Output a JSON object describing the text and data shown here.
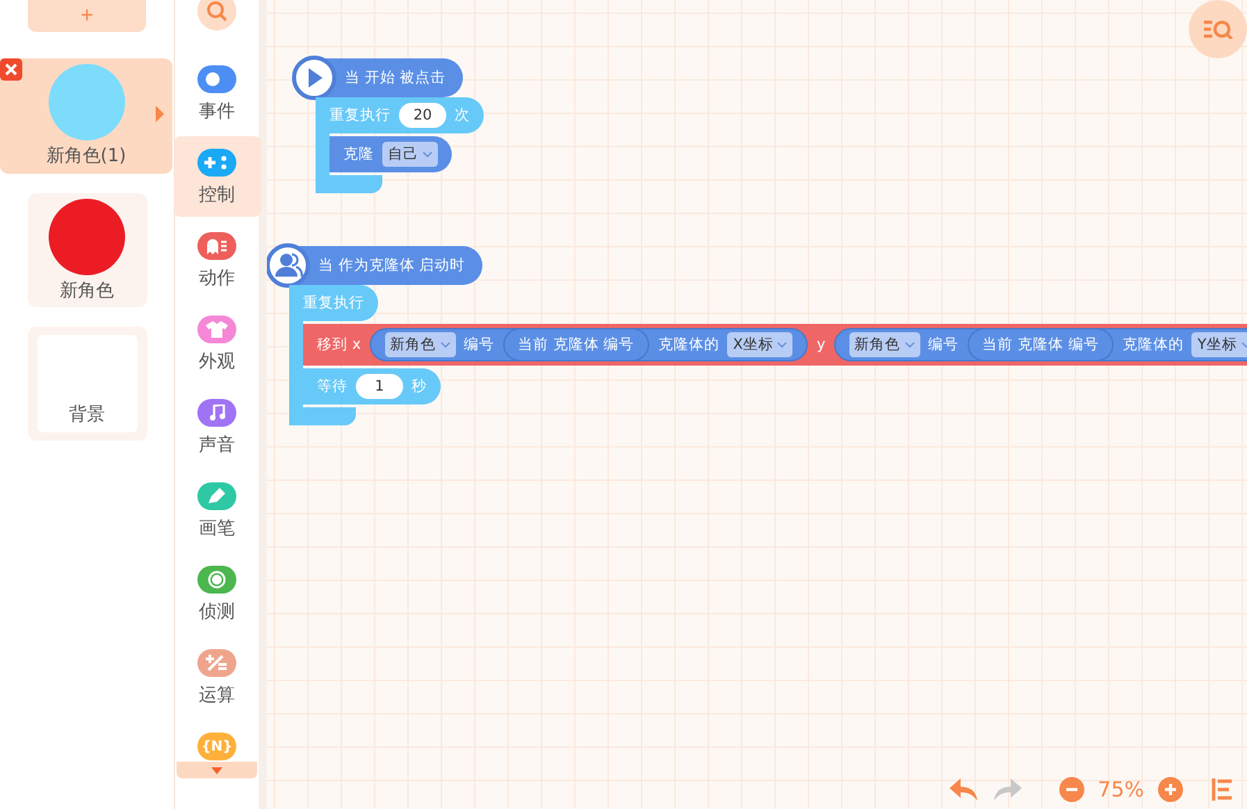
{
  "sprite_panel": {
    "add_label": "+",
    "items": [
      {
        "kind": "sprite",
        "name": "新角色(1)",
        "color": "#7ddcfc",
        "selected": true
      },
      {
        "kind": "sprite",
        "name": "新角色",
        "color": "#ec1c24",
        "selected": false
      },
      {
        "kind": "backdrop",
        "name": "背景",
        "selected": false
      }
    ]
  },
  "categories": [
    {
      "label": "事件",
      "color": "#4d8ef5",
      "selected": false
    },
    {
      "label": "控制",
      "color": "#1aa9f5",
      "selected": true
    },
    {
      "label": "动作",
      "color": "#ee5f5b",
      "selected": false
    },
    {
      "label": "外观",
      "color": "#f587d6",
      "selected": false
    },
    {
      "label": "声音",
      "color": "#a073f5",
      "selected": false
    },
    {
      "label": "画笔",
      "color": "#2ec9a4",
      "selected": false
    },
    {
      "label": "侦测",
      "color": "#4cb64f",
      "selected": false
    },
    {
      "label": "运算",
      "color": "#efa58c",
      "selected": false
    },
    {
      "icon_text": "{N}",
      "color": "#ffb03a",
      "selected": false
    }
  ],
  "scripts": [
    {
      "hat": {
        "kind": "start",
        "label": "当 开始 被点击"
      },
      "blocks": [
        {
          "kind": "c",
          "color": "#67c9f8",
          "parts": [
            {
              "kind": "text",
              "text": "重复执行"
            },
            {
              "kind": "number",
              "text": "20"
            },
            {
              "kind": "text",
              "text": "次"
            }
          ],
          "children": [
            {
              "kind": "stack",
              "color": "#5b8fe6",
              "parts": [
                {
                  "kind": "text",
                  "text": "克隆"
                },
                {
                  "kind": "dropdown",
                  "text": "自己"
                }
              ]
            }
          ]
        }
      ]
    },
    {
      "hat": {
        "kind": "clone_start",
        "label": "当 作为克隆体 启动时"
      },
      "blocks": [
        {
          "kind": "c",
          "color": "#67c9f8",
          "parts": [
            {
              "kind": "text",
              "text": "重复执行"
            }
          ],
          "children": [
            {
              "kind": "stack",
              "color": "#ef6666",
              "parts": [
                {
                  "kind": "text",
                  "text": "移到 x"
                },
                {
                  "kind": "reporter",
                  "parts": [
                    {
                      "kind": "dropdown",
                      "text": "新角色"
                    },
                    {
                      "kind": "text",
                      "text": "编号"
                    },
                    {
                      "kind": "reporter",
                      "parts": [
                        {
                          "kind": "text",
                          "text": "当前 克隆体 编号"
                        }
                      ]
                    },
                    {
                      "kind": "text",
                      "text": "克隆体的"
                    },
                    {
                      "kind": "dropdown",
                      "text": "X坐标"
                    }
                  ]
                },
                {
                  "kind": "text",
                  "text": "y"
                },
                {
                  "kind": "reporter",
                  "parts": [
                    {
                      "kind": "dropdown",
                      "text": "新角色"
                    },
                    {
                      "kind": "text",
                      "text": "编号"
                    },
                    {
                      "kind": "reporter",
                      "parts": [
                        {
                          "kind": "text",
                          "text": "当前 克隆体 编号"
                        }
                      ]
                    },
                    {
                      "kind": "text",
                      "text": "克隆体的"
                    },
                    {
                      "kind": "dropdown",
                      "text": "Y坐标"
                    }
                  ]
                }
              ]
            },
            {
              "kind": "stack",
              "color": "#67c9f8",
              "parts": [
                {
                  "kind": "text",
                  "text": "等待"
                },
                {
                  "kind": "number",
                  "text": "1"
                },
                {
                  "kind": "text",
                  "text": "秒"
                }
              ]
            }
          ]
        }
      ]
    }
  ],
  "toolbar": {
    "undo": {
      "disabled": false
    },
    "redo": {
      "disabled": true
    },
    "zoom": "75%"
  }
}
